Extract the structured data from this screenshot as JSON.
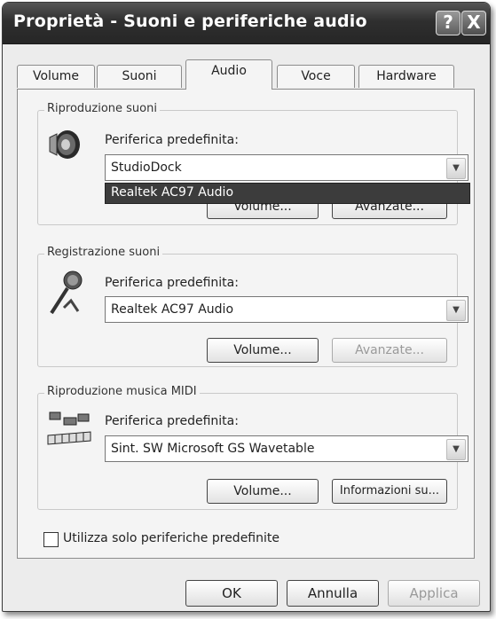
{
  "window": {
    "title": "Proprietà - Suoni e periferiche audio"
  },
  "title_buttons": {
    "help": "?",
    "close": "X"
  },
  "tabs": [
    "Volume",
    "Suoni",
    "Audio",
    "Voce",
    "Hardware"
  ],
  "active_tab": "Audio",
  "playback": {
    "group_label": "Riproduzione suoni",
    "device_label": "Periferica predefinita:",
    "selected": "StudioDock",
    "dropdown_highlight": "Realtek AC97 Audio",
    "volume_button": "Volume...",
    "advanced_button": "Avanzate..."
  },
  "recording": {
    "group_label": "Registrazione suoni",
    "device_label": "Periferica predefinita:",
    "selected": "Realtek AC97 Audio",
    "volume_button": "Volume...",
    "advanced_button": "Avanzate..."
  },
  "midi": {
    "group_label": "Riproduzione musica MIDI",
    "device_label": "Periferica predefinita:",
    "selected": "Sint. SW Microsoft GS Wavetable",
    "volume_button": "Volume...",
    "info_button": "Informazioni su..."
  },
  "checkbox_label": "Utilizza solo periferiche predefinite",
  "footer": {
    "ok": "OK",
    "cancel": "Annulla",
    "apply": "Applica"
  }
}
